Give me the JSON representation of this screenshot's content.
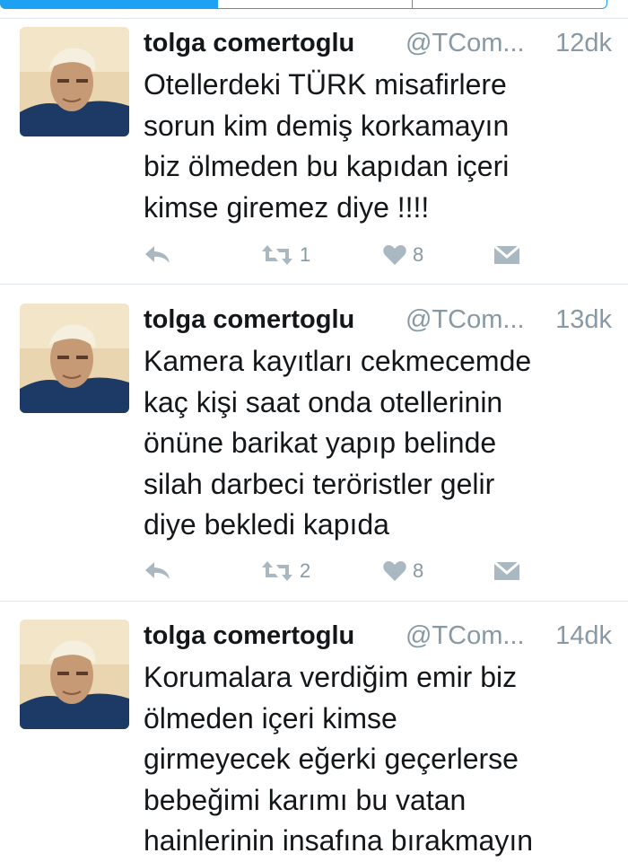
{
  "tweets": [
    {
      "name": "tolga comertoglu",
      "handle": "@TCom...",
      "time": "12dk",
      "lines": [
        "Otellerdeki TÜRK misafirlere",
        "sorun kim demiş korkamayın",
        "biz ölmeden bu kapıdan içeri",
        "kimse giremez diye !!!!"
      ],
      "retweets": "1",
      "likes": "8"
    },
    {
      "name": "tolga comertoglu",
      "handle": "@TCom...",
      "time": "13dk",
      "lines": [
        "Kamera kayıtları cekmecemde",
        "kaç kişi saat onda otellerinin",
        "önüne barikat yapıp belinde",
        "silah darbeci teröristler gelir",
        "diye bekledi kapıda"
      ],
      "retweets": "2",
      "likes": "8"
    },
    {
      "name": "tolga comertoglu",
      "handle": "@TCom...",
      "time": "14dk",
      "lines": [
        "Korumalara verdiğim emir biz",
        "ölmeden içeri kimse",
        "girmeyecek eğerki geçerlerse",
        "bebeğimi karımı bu vatan",
        "hainlerinin insafına bırakmayın"
      ]
    }
  ],
  "icons": {
    "reply": "reply-icon",
    "retweet": "retweet-icon",
    "like": "heart-icon",
    "dm": "envelope-icon"
  },
  "colors": {
    "accent": "#1da1f2",
    "icon_gray": "#aab8c2",
    "meta_gray": "#8899a6",
    "text": "#14171a"
  }
}
